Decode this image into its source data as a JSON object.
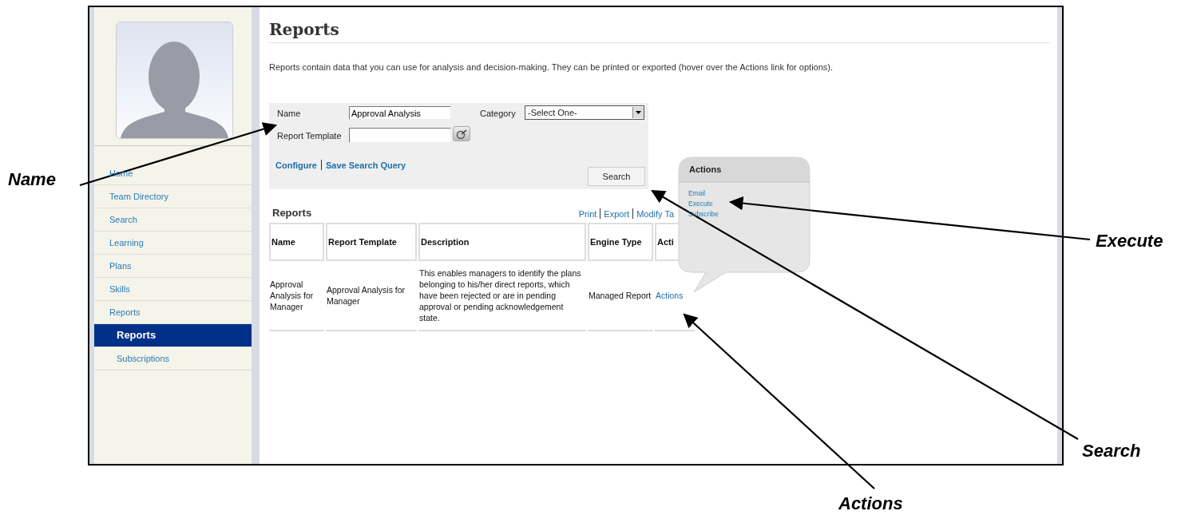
{
  "sidebar": {
    "items": [
      {
        "label": "Home",
        "selected": false
      },
      {
        "label": "Team Directory",
        "selected": false
      },
      {
        "label": "Search",
        "selected": false
      },
      {
        "label": "Learning",
        "selected": false
      },
      {
        "label": "Plans",
        "selected": false
      },
      {
        "label": "Skills",
        "selected": false
      },
      {
        "label": "Reports",
        "selected": false,
        "children": [
          {
            "label": "Reports",
            "selected": true
          },
          {
            "label": "Subscriptions",
            "selected": false
          }
        ]
      }
    ]
  },
  "page": {
    "title": "Reports",
    "description": "Reports contain data that you can use for analysis and decision-making. They can be printed or exported (hover over the Actions link for options)."
  },
  "search_form": {
    "name_label": "Name",
    "name_value": "Approval Analysis",
    "category_label": "Category",
    "category_value": "-Select One-",
    "template_label": "Report Template",
    "links": [
      "Configure",
      "Save Search Query"
    ],
    "search_button": "Search"
  },
  "results": {
    "title": "Reports",
    "links": [
      "Print",
      "Export",
      "Modify Ta"
    ],
    "columns": [
      "Name",
      "Report Template",
      "Description",
      "Engine Type",
      "Acti"
    ],
    "rows": [
      [
        "Approval Analysis for Manager",
        "Approval Analysis for Manager",
        "This enables managers to identify the plans belonging to his/her direct reports, which have been rejected or are in pending approval or pending acknowledgement state.",
        "Managed Report",
        "Actions"
      ]
    ]
  },
  "actions_popup": {
    "title": "Actions",
    "items": [
      "Email",
      "Execute",
      "Subscribe"
    ]
  },
  "callouts": [
    "Name",
    "Execute",
    "Search",
    "Actions"
  ]
}
